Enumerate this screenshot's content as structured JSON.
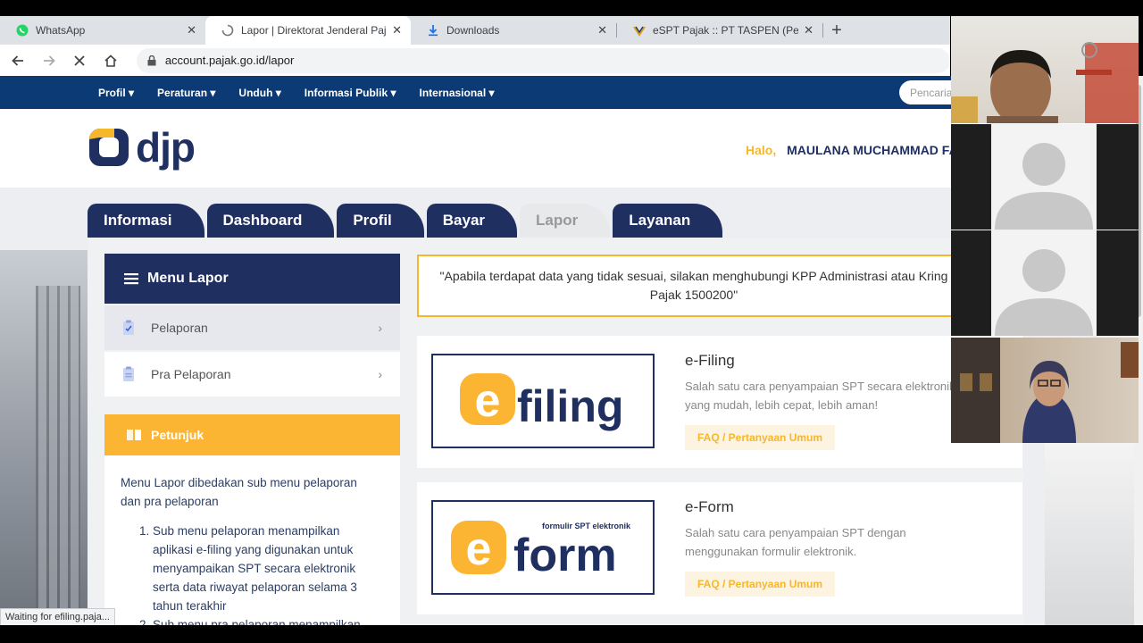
{
  "browser": {
    "tabs": [
      {
        "title": "WhatsApp",
        "icon": "whatsapp-icon"
      },
      {
        "title": "Lapor | Direktorat Jenderal Pajak",
        "icon": "loading-spinner-icon"
      },
      {
        "title": "Downloads",
        "icon": "download-icon"
      },
      {
        "title": "eSPT Pajak :: PT TASPEN (Persero)",
        "icon": "espt-favicon-icon"
      }
    ],
    "url": "account.pajak.go.id/lapor",
    "status": "Waiting for efiling.paja..."
  },
  "topnav": {
    "items": [
      "Profil",
      "Peraturan",
      "Unduh",
      "Informasi Publik",
      "Internasional"
    ],
    "search_placeholder": "Pencaria"
  },
  "header": {
    "logo_text": "djp",
    "greeting_prefix": "Halo,",
    "username": "MAULANA MUCHAMMAD FAQ"
  },
  "main_tabs": [
    "Informasi",
    "Dashboard",
    "Profil",
    "Bayar",
    "Lapor",
    "Layanan"
  ],
  "active_tab": "Lapor",
  "sidebar": {
    "menu_title": "Menu Lapor",
    "items": [
      "Pelaporan",
      "Pra Pelaporan"
    ],
    "petunjuk_title": "Petunjuk",
    "petunjuk_intro": "Menu Lapor dibedakan sub menu pelaporan dan pra pelaporan",
    "petunjuk_points": [
      "Sub menu pelaporan menampilkan aplikasi e-filing yang digunakan untuk menyampaikan SPT secara elektronik serta data riwayat pelaporan selama 3 tahun terakhir",
      "Sub menu pra pelaporan menampilkan"
    ]
  },
  "notice": "\"Apabila terdapat data yang tidak sesuai, silakan menghubungi KPP Administrasi atau Kring Pajak 1500200\"",
  "cards": [
    {
      "logo_letter": "e",
      "logo_word": "filing",
      "title": "e-Filing",
      "desc": "Salah satu cara penyampaian SPT secara elektronik yang mudah, lebih cepat, lebih aman!",
      "faq": "FAQ / Pertanyaan Umum"
    },
    {
      "logo_letter": "e",
      "logo_word": "form",
      "logo_sub": "formulir SPT elektronik",
      "title": "e-Form",
      "desc": "Salah satu cara penyampaian SPT dengan menggunakan formulir elektronik.",
      "faq": "FAQ / Pertanyaan Umum"
    }
  ],
  "colors": {
    "navy": "#0b3a75",
    "dark_blue": "#1f2f60",
    "accent_yellow": "#fbb533"
  }
}
